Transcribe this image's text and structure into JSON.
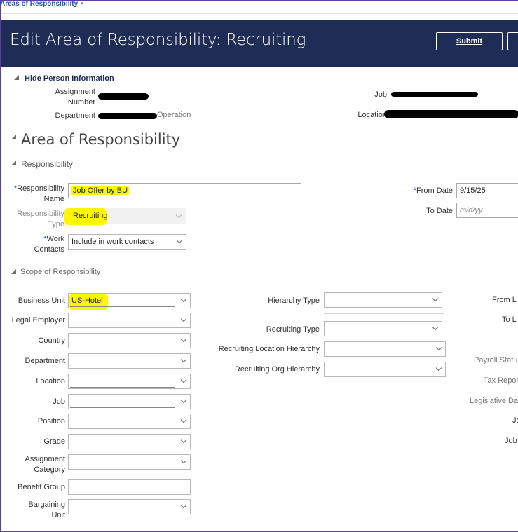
{
  "tab": {
    "label": "Areas of Responsibility",
    "close": "×"
  },
  "header": {
    "title": "Edit Area of Responsibility: Recruiting",
    "submit_label": "Submit"
  },
  "person": {
    "toggle_label": "Hide Person Information",
    "assignment_number_label": "Assignment Number",
    "assignment_number_line1": "Assignment",
    "assignment_number_line2": "Number",
    "department_label": "Department",
    "department_value_suffix": "Operation",
    "job_label": "Job",
    "location_label": "Location"
  },
  "aor": {
    "heading": "Area of Responsibility",
    "responsibility_heading": "Responsibility",
    "responsibility_name_l1": "Responsibility",
    "responsibility_name_l2": "Name",
    "responsibility_name_value": "Job Offer by BU",
    "responsibility_type_l1": "Responsibility",
    "responsibility_type_l2": "Type",
    "responsibility_type_value": "Recruiting",
    "work_contacts_l1": "Work",
    "work_contacts_l2": "Contacts",
    "work_contacts_value": "Include in work contacts",
    "from_date_label": "From Date",
    "from_date_value": "9/15/25",
    "to_date_label": "To Date",
    "to_date_placeholder": "m/d/yy"
  },
  "scope": {
    "heading": "Scope of Responsibility",
    "business_unit_label": "Business Unit",
    "business_unit_value": "US-Hotel",
    "legal_employer_label": "Legal Employer",
    "country_label": "Country",
    "department_label": "Department",
    "location_label": "Location",
    "job_label": "Job",
    "position_label": "Position",
    "grade_label": "Grade",
    "assignment_category_l1": "Assignment",
    "assignment_category_l2": "Category",
    "benefit_group_label": "Benefit Group",
    "bargaining_unit_l1": "Bargaining",
    "bargaining_unit_l2": "Unit",
    "hierarchy_type_label": "Hierarchy Type",
    "recruiting_type_label": "Recruiting Type",
    "recruiting_location_hierarchy_label": "Recruiting Location Hierarchy",
    "recruiting_org_hierarchy_label": "Recruiting Org Hierarchy",
    "right_partial": {
      "from_l": "From L",
      "to_l": "To L",
      "payroll_status": "Payroll Statu",
      "tax_report": "Tax Repor",
      "legislative_da": "Legislative Da",
      "jo": "Jo",
      "job": "Job"
    }
  },
  "colors": {
    "header_bg": "#1f2d56",
    "highlight": "#fff700",
    "link": "#2255a4",
    "frame": "#5b3fa0"
  }
}
